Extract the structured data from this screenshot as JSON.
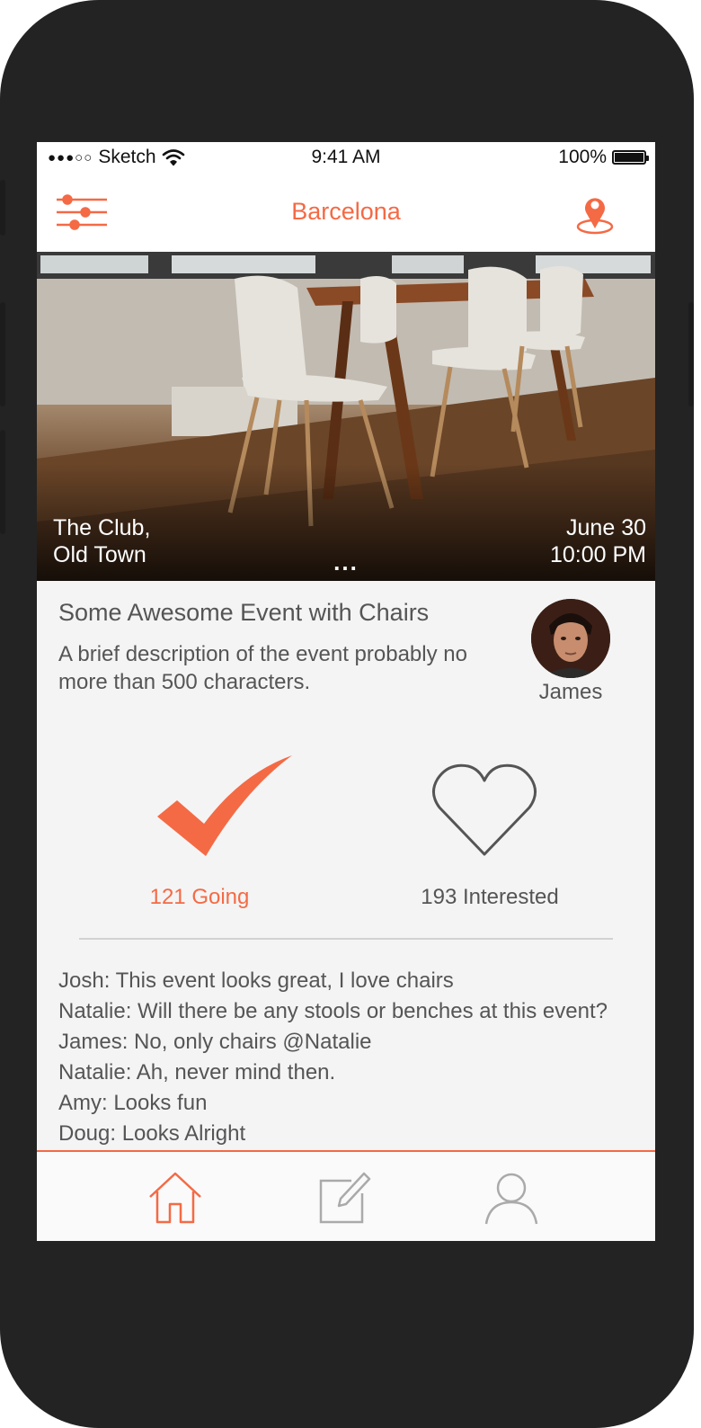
{
  "status_bar": {
    "carrier": "Sketch",
    "time": "9:41 AM",
    "battery": "100%",
    "battery_level": 1.0,
    "signal_bars_filled": 3,
    "signal_bars_total": 5
  },
  "nav": {
    "title": "Barcelona",
    "left_icon": "filter-sliders-icon",
    "right_icon": "location-pin-icon"
  },
  "hero": {
    "venue_line1": "The Club,",
    "venue_line2": "Old Town",
    "date": "June 30",
    "time": "10:00 PM",
    "pager": "..."
  },
  "event": {
    "title": "Some Awesome Event with Chairs",
    "description": "A brief description of the event probably no more than 500 characters.",
    "host_name": "James"
  },
  "actions": {
    "going_label": "121 Going",
    "going_icon": "checkmark-icon",
    "interested_label": "193 Interested",
    "interested_icon": "heart-icon"
  },
  "comments": [
    "Josh: This event looks great, I love chairs",
    "Natalie: Will there be any stools or benches at this event?",
    "James: No, only chairs @Natalie",
    "Natalie: Ah, never mind then.",
    "Amy: Looks fun",
    "Doug: Looks Alright"
  ],
  "tabs": [
    {
      "icon": "home-icon",
      "active": true
    },
    {
      "icon": "compose-icon",
      "active": false
    },
    {
      "icon": "profile-icon",
      "active": false
    }
  ],
  "colors": {
    "accent": "#f46a45",
    "text": "#555555",
    "background": "#f4f4f4"
  }
}
